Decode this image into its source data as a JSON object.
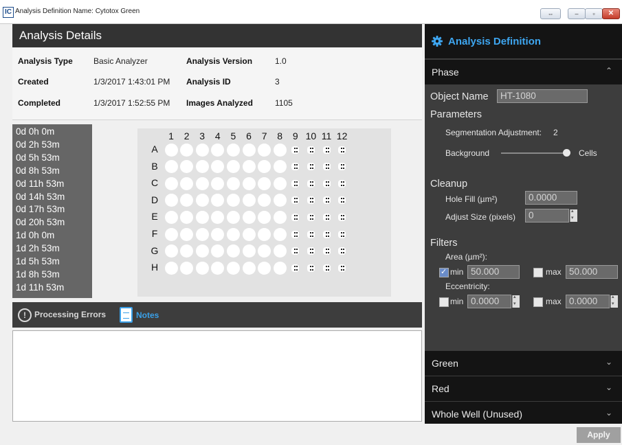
{
  "window": {
    "app_icon": "IC",
    "title": "Analysis Definition Name: Cytotox Green",
    "buttons": [
      "restore",
      "minimize",
      "maximize",
      "close"
    ]
  },
  "details": {
    "title": "Analysis Details",
    "analysis_type_label": "Analysis Type",
    "analysis_type_value": "Basic Analyzer",
    "analysis_version_label": "Analysis Version",
    "analysis_version_value": "1.0",
    "created_label": "Created",
    "created_value": "1/3/2017 1:43:01 PM",
    "analysis_id_label": "Analysis ID",
    "analysis_id_value": "3",
    "completed_label": "Completed",
    "completed_value": "1/3/2017 1:52:55 PM",
    "images_analyzed_label": "Images Analyzed",
    "images_analyzed_value": "1105"
  },
  "timepoints": [
    "0d 0h 0m",
    "0d 2h 53m",
    "0d 5h 53m",
    "0d 8h 53m",
    "0d 11h 53m",
    "0d 14h 53m",
    "0d 17h 53m",
    "0d 20h 53m",
    "1d 0h 0m",
    "1d 2h 53m",
    "1d 5h 53m",
    "1d 8h 53m",
    "1d 11h 53m"
  ],
  "plate": {
    "columns": [
      "1",
      "2",
      "3",
      "4",
      "5",
      "6",
      "7",
      "8",
      "9",
      "10",
      "11",
      "12"
    ],
    "rows": [
      "A",
      "B",
      "C",
      "D",
      "E",
      "F",
      "G",
      "H"
    ],
    "selected_columns": [
      9,
      10,
      11,
      12
    ]
  },
  "notes_bar": {
    "errors_label": "Processing Errors",
    "notes_label": "Notes"
  },
  "apply_label": "Apply",
  "panel": {
    "title": "Analysis Definition",
    "phase_label": "Phase",
    "object_name_label": "Object Name",
    "object_name_value": "HT-1080",
    "parameters_label": "Parameters",
    "segmentation_label": "Segmentation Adjustment:",
    "segmentation_value": "2",
    "background_label": "Background",
    "cells_label": "Cells",
    "cleanup_label": "Cleanup",
    "hole_fill_label": "Hole Fill (µm²)",
    "hole_fill_value": "0.0000",
    "adjust_size_label": "Adjust Size (pixels)",
    "adjust_size_value": "0",
    "filters_label": "Filters",
    "area_label": "Area (µm²):",
    "area_min_label": "min",
    "area_min_value": "50.000",
    "area_min_checked": true,
    "area_max_label": "max",
    "area_max_value": "50.000",
    "area_max_checked": false,
    "ecc_label": "Eccentricity:",
    "ecc_min_label": "min",
    "ecc_min_value": "0.0000",
    "ecc_max_label": "max",
    "ecc_max_value": "0.0000",
    "green_label": "Green",
    "red_label": "Red",
    "whole_well_label": "Whole Well (Unused)"
  },
  "colors": {
    "accent": "#3ea6f0",
    "panel_dark": "#141414",
    "panel_mid": "#3d3d3d"
  }
}
